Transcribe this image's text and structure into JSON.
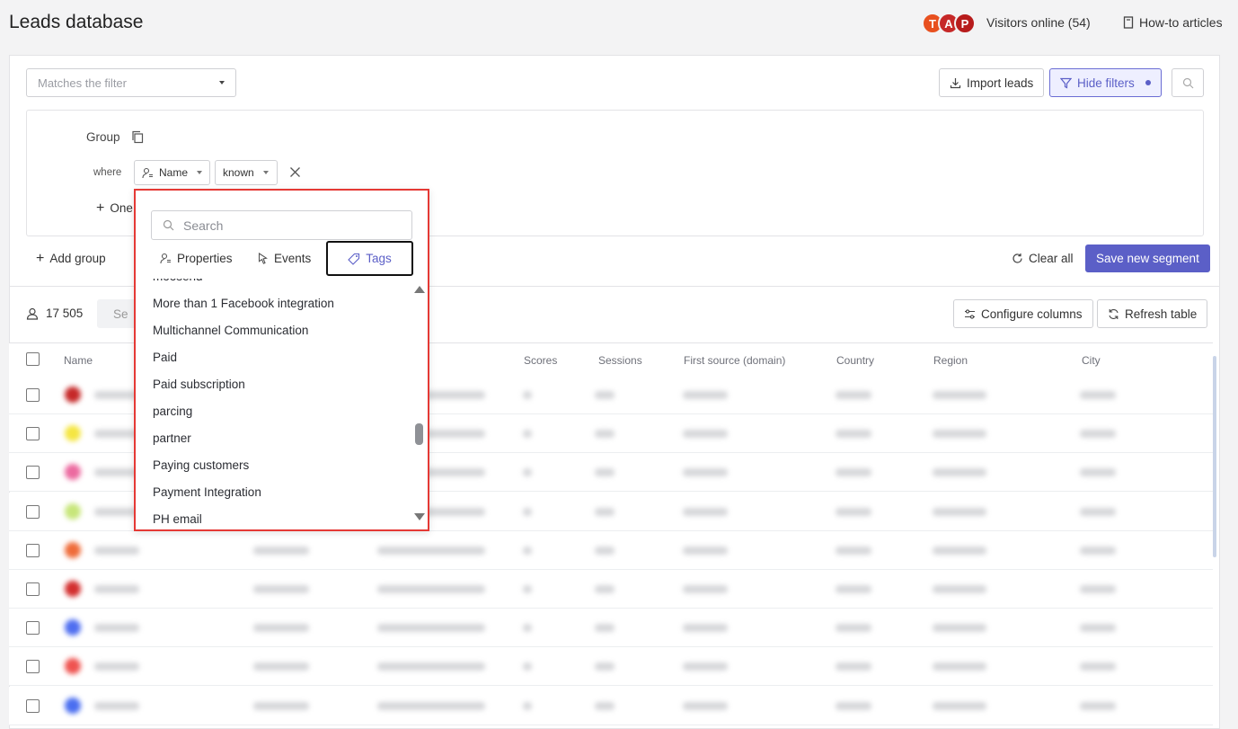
{
  "header": {
    "title": "Leads database",
    "avatars": [
      {
        "letter": "T",
        "color": "#e8501f"
      },
      {
        "letter": "A",
        "color": "#c62828"
      },
      {
        "letter": "P",
        "color": "#b71c1c"
      }
    ],
    "visitors_online": "Visitors online (54)",
    "howto_label": "How-to articles"
  },
  "toolbar": {
    "filter_placeholder": "Matches the filter",
    "import_label": "Import leads",
    "hide_filters_label": "Hide filters"
  },
  "filter_group": {
    "group_label": "Group",
    "where_label": "where",
    "property_select": "Name",
    "condition_select": "known",
    "add_condition_label": "One"
  },
  "actions": {
    "add_group_label": "Add group",
    "clear_all_label": "Clear all",
    "save_segment_label": "Save new segment"
  },
  "table_toolbar": {
    "lead_count": "17 505",
    "send_label": "Se",
    "configure_columns_label": "Configure columns",
    "refresh_table_label": "Refresh table"
  },
  "table": {
    "columns": [
      "Name",
      "Scores",
      "Sessions",
      "First source (domain)",
      "Country",
      "Region",
      "City"
    ],
    "rows": [
      {
        "dot_color": "#c62828"
      },
      {
        "dot_color": "#f5e642"
      },
      {
        "dot_color": "#ec6aa0"
      },
      {
        "dot_color": "#c7e67a"
      },
      {
        "dot_color": "#ef6c3a"
      },
      {
        "dot_color": "#d32f2f"
      },
      {
        "dot_color": "#4f6ef0"
      },
      {
        "dot_color": "#ef5350"
      },
      {
        "dot_color": "#4a6ef0"
      }
    ]
  },
  "dropdown": {
    "search_placeholder": "Search",
    "tabs": [
      {
        "label": "Properties",
        "icon": "person-list-icon"
      },
      {
        "label": "Events",
        "icon": "cursor-icon"
      },
      {
        "label": "Tags",
        "icon": "tag-icon",
        "active": true
      }
    ],
    "partial_item": "moosend",
    "items": [
      "More than 1 Facebook integration",
      "Multichannel Communication",
      "Paid",
      "Paid subscription",
      "parcing",
      "partner",
      "Paying customers",
      "Payment Integration",
      "PH email"
    ]
  },
  "colors": {
    "accent": "#5b5fc7",
    "highlight_border": "#e53935"
  }
}
